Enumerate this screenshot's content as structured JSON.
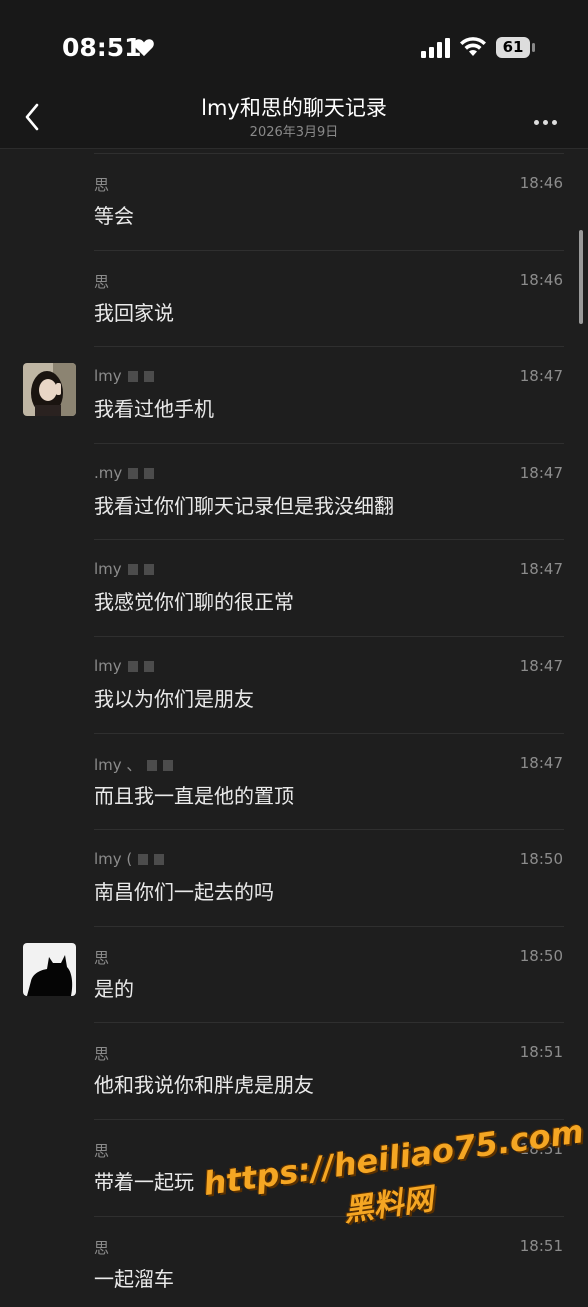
{
  "status": {
    "time": "08:51",
    "battery": "61"
  },
  "nav": {
    "title": "lmy和思的聊天记录",
    "subtitle": "2026年3月9日"
  },
  "messages": [
    {
      "sender": "思",
      "time": "18:46",
      "text": "等会",
      "avatar": ""
    },
    {
      "sender": "思",
      "time": "18:46",
      "text": "我回家说",
      "avatar": ""
    },
    {
      "sender": "lmy",
      "time": "18:47",
      "text": "我看过他手机",
      "avatar": "girl"
    },
    {
      "sender": ".my",
      "time": "18:47",
      "text": "我看过你们聊天记录但是我没细翻",
      "avatar": ""
    },
    {
      "sender": "lmy",
      "time": "18:47",
      "text": "我感觉你们聊的很正常",
      "avatar": ""
    },
    {
      "sender": "lmy",
      "time": "18:47",
      "text": "我以为你们是朋友",
      "avatar": ""
    },
    {
      "sender": "lmy 、",
      "time": "18:47",
      "text": "而且我一直是他的置顶",
      "avatar": ""
    },
    {
      "sender": "lmy (",
      "time": "18:50",
      "text": "南昌你们一起去的吗",
      "avatar": ""
    },
    {
      "sender": "思",
      "time": "18:50",
      "text": "是的",
      "avatar": "cat"
    },
    {
      "sender": "思",
      "time": "18:51",
      "text": "他和我说你和胖虎是朋友",
      "avatar": ""
    },
    {
      "sender": "思",
      "time": "18:51",
      "text": "带着一起玩",
      "avatar": ""
    },
    {
      "sender": "思",
      "time": "18:51",
      "text": "一起溜车",
      "avatar": ""
    }
  ],
  "watermark": {
    "url": "https://heiliao75.com",
    "name": "黑料网"
  }
}
